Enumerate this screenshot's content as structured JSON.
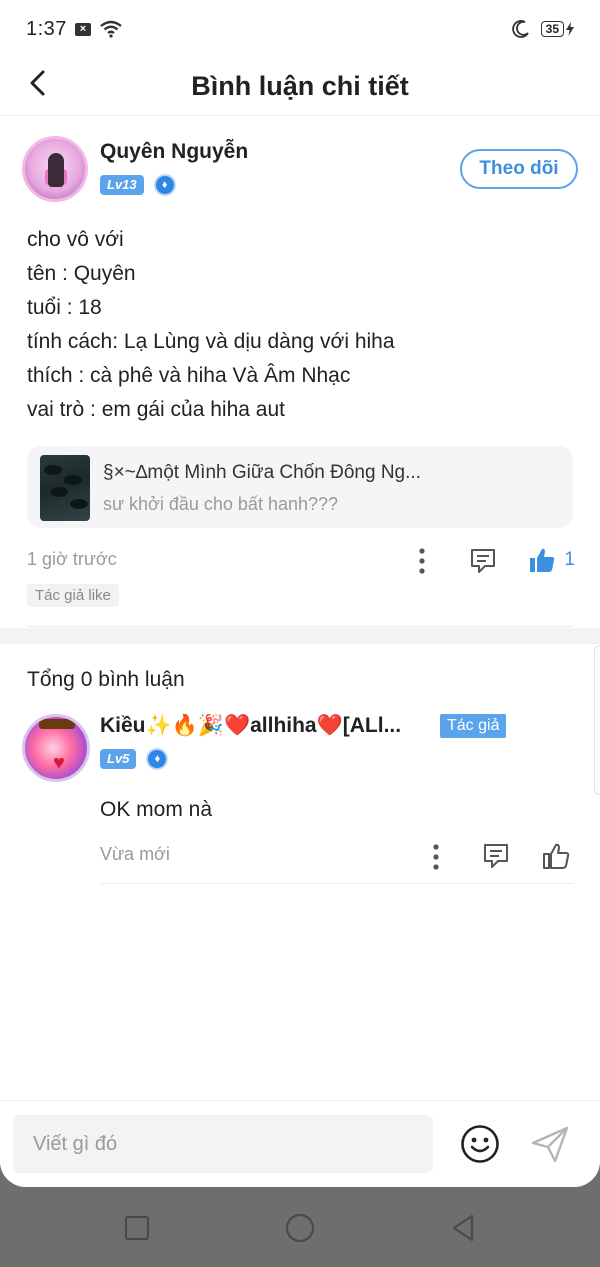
{
  "status_bar": {
    "time": "1:37",
    "battery": "35"
  },
  "header": {
    "title": "Bình luận chi tiết"
  },
  "post": {
    "author_name": "Quyên Nguyễn",
    "level": "Lv13",
    "follow_label": "Theo dõi",
    "lines": [
      "cho vô với",
      "tên : Quyên",
      "tuổi : 18",
      "tính cách: Lạ Lùng và dịu dàng với hiha",
      "thích : cà phê và hiha Và Âm Nhạc",
      "vai trò : em gái của hiha aut"
    ],
    "book": {
      "title": "§×~∆một Mình Giữa Chốn Đông Ng...",
      "subtitle": "sư khởi đầu cho bất hanh???"
    },
    "time_ago": "1 giờ trước",
    "like_count": "1",
    "author_like_tag": "Tác giả like"
  },
  "comments": {
    "total_label": "Tổng 0 bình luận",
    "items": [
      {
        "name": "Kiều✨🔥🎉❤️allhiha❤️[ALl...",
        "author_tag": "Tác giả",
        "level": "Lv5",
        "text": "OK mom nà",
        "time_ago": "Vừa mới"
      }
    ]
  },
  "input": {
    "placeholder": "Viết gì đó"
  },
  "icons": {
    "back": "chevron-left-icon",
    "more": "more-vertical-icon",
    "reply": "comment-icon",
    "like": "thumbs-up-icon",
    "emoji": "smiley-icon",
    "send": "send-icon"
  },
  "colors": {
    "accent": "#3d8fe0",
    "badge": "#5ba3ea",
    "nav_bar": "#6e6e6e"
  }
}
